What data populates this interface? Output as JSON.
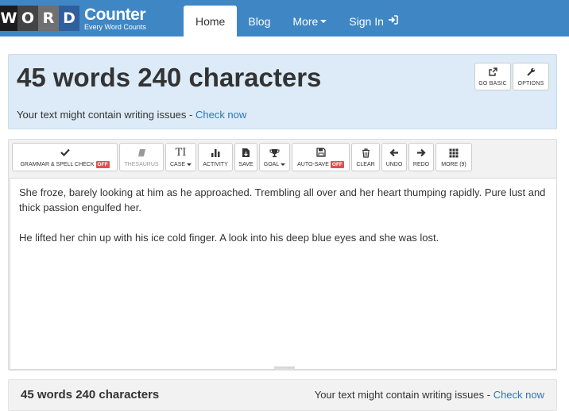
{
  "logo": {
    "letters": [
      "W",
      "O",
      "R",
      "D"
    ],
    "main": "Counter",
    "sub": "Every Word Counts"
  },
  "nav": {
    "home": "Home",
    "blog": "Blog",
    "more": "More",
    "signin": "Sign In"
  },
  "header": {
    "title": "45 words 240 characters",
    "issue_text": "Your text might contain writing issues - ",
    "issue_link": "Check now",
    "go_basic": "GO BASIC",
    "options": "OPTIONS"
  },
  "toolbar": {
    "grammar": "GRAMMAR & SPELL CHECK",
    "grammar_state": "OFF",
    "thesaurus": "THESAURUS",
    "case": "CASE",
    "activity": "ACTIVITY",
    "save": "SAVE",
    "goal": "GOAL",
    "autosave": "AUTO-SAVE",
    "autosave_state": "OFF",
    "clear": "CLEAR",
    "undo": "UNDO",
    "redo": "REDO",
    "more": "MORE (9)"
  },
  "editor": {
    "paragraph1": "She froze, barely looking at him as he approached. Trembling all over and her heart thumping rapidly. Pure lust and thick passion engulfed her.",
    "paragraph2": "He lifted her chin up with his ice cold finger. A look into his deep blue eyes and she was lost."
  },
  "footer": {
    "count": "45 words 240 characters",
    "issue_text": "Your text might contain writing issues - ",
    "issue_link": "Check now"
  },
  "colors": {
    "navbar": "#3f86c5",
    "header_panel": "#dcebf7",
    "link": "#2f74b8",
    "badge_off": "#d9534f"
  }
}
